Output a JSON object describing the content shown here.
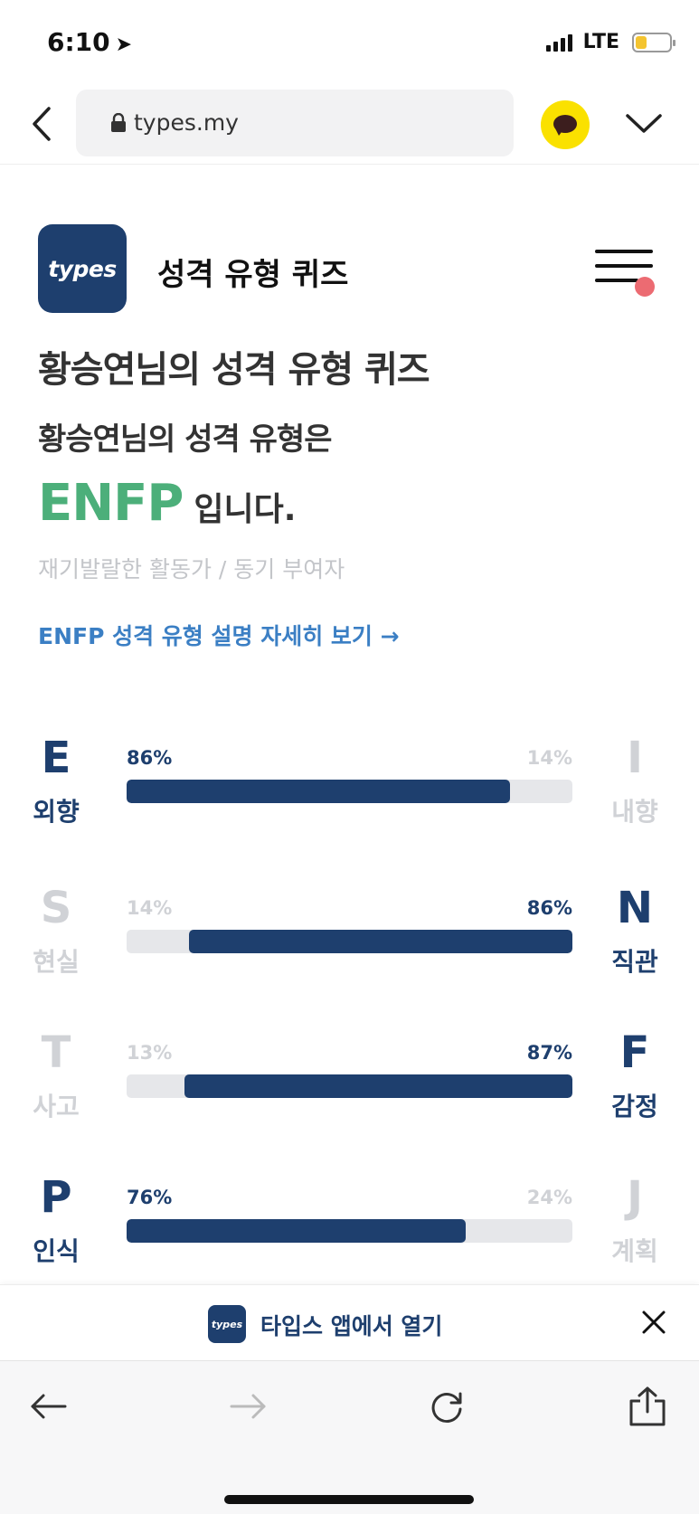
{
  "status": {
    "time": "6:10",
    "network": "LTE"
  },
  "browser": {
    "url": "types.my"
  },
  "site": {
    "logo_text": "types",
    "title": "성격 유형 퀴즈"
  },
  "result": {
    "heading": "황승연님의 성격 유형 퀴즈",
    "subheading": "황승연님의 성격 유형은",
    "type": "ENFP",
    "type_suffix": "입니다.",
    "description": "재기발랄한 활동가 / 동기 부여자",
    "detail_link": "ENFP 성격 유형 설명 자세히 보기 →"
  },
  "traits": [
    {
      "left_letter": "E",
      "left_name": "외향",
      "left_pct": "86%",
      "right_letter": "I",
      "right_name": "내향",
      "right_pct": "14%",
      "dominant": "left",
      "dominant_value": 0.86
    },
    {
      "left_letter": "S",
      "left_name": "현실",
      "left_pct": "14%",
      "right_letter": "N",
      "right_name": "직관",
      "right_pct": "86%",
      "dominant": "right",
      "dominant_value": 0.86
    },
    {
      "left_letter": "T",
      "left_name": "사고",
      "left_pct": "13%",
      "right_letter": "F",
      "right_name": "감정",
      "right_pct": "87%",
      "dominant": "right",
      "dominant_value": 0.87
    },
    {
      "left_letter": "P",
      "left_name": "인식",
      "left_pct": "76%",
      "right_letter": "J",
      "right_name": "계획",
      "right_pct": "24%",
      "dominant": "left",
      "dominant_value": 0.76
    }
  ],
  "app_banner": {
    "logo_text": "types",
    "text": "타입스 앱에서 열기"
  },
  "colors": {
    "brand_navy": "#1e3f6e",
    "result_green": "#4caf7a",
    "link_blue": "#3b7fc4",
    "muted_gray": "#d0d2d6",
    "kakao_yellow": "#fae100",
    "notification_red": "#ec6b72"
  },
  "icons": {
    "back": "chevron-left-icon",
    "lock": "lock-icon",
    "kakao": "kakaotalk-icon",
    "expand": "chevron-down-icon",
    "menu": "hamburger-menu-icon",
    "close": "close-icon",
    "nav_back": "arrow-left-icon",
    "nav_forward": "arrow-right-icon",
    "reload": "reload-icon",
    "share": "share-icon"
  }
}
